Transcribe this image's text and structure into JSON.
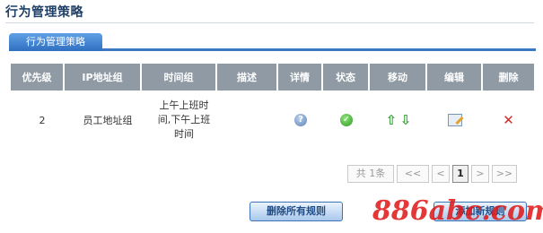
{
  "header": {
    "title": "行为管理策略"
  },
  "tab": {
    "label": "行为管理策略"
  },
  "table": {
    "columns": [
      "优先级",
      "IP地址组",
      "时间组",
      "描述",
      "详情",
      "状态",
      "移动",
      "编辑",
      "删除"
    ],
    "rows": [
      {
        "priority": "2",
        "ip_group": "员工地址组",
        "time_group_lines": [
          "上午上班时",
          "间,下午上班",
          "时间"
        ],
        "description": "",
        "icons": {
          "detail": "help-icon",
          "status": "enabled-check-icon",
          "move": "move-up-down-icon",
          "edit": "edit-icon",
          "delete": "delete-icon"
        }
      }
    ]
  },
  "pager": {
    "total": "共 1条",
    "first": "<<",
    "prev": "<",
    "current": "1",
    "next": ">",
    "last": ">>"
  },
  "buttons": {
    "delete_all": "删除所有规则",
    "add_new": "添加新规则"
  },
  "watermark": "886abc.com",
  "colors": {
    "accent": "#3a78c2",
    "header_bg": "#8f9aa5",
    "delete_red": "#d92a2a",
    "ok_green": "#2f9a23"
  }
}
